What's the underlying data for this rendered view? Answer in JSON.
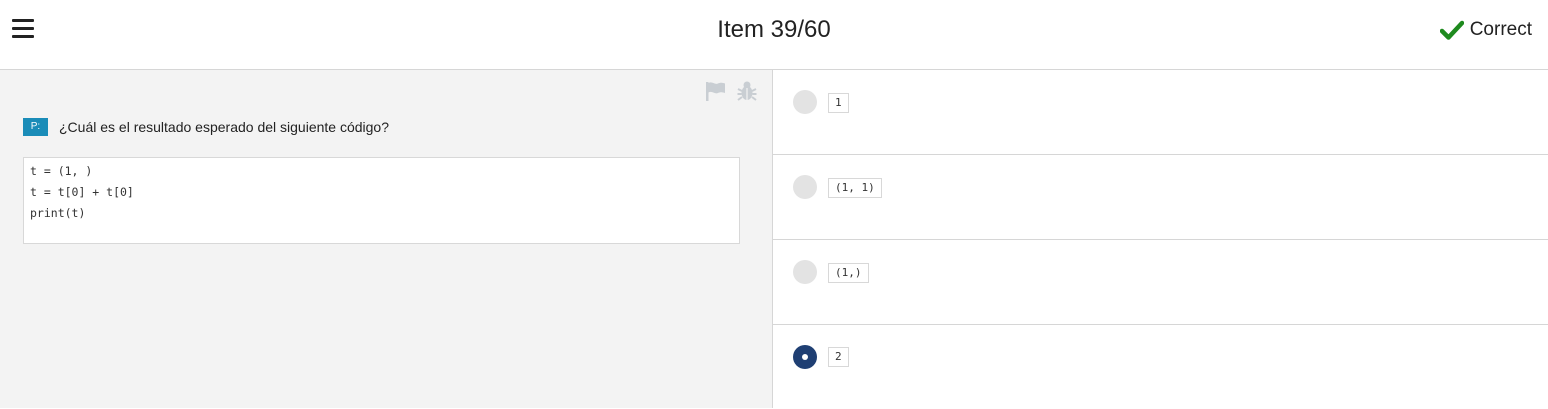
{
  "header": {
    "title": "Item 39/60",
    "status_label": "Correct",
    "status_color": "#1e8a1e",
    "menu_icon": "hamburger-menu-icon"
  },
  "question": {
    "badge": "P:",
    "text": "¿Cuál es el resultado esperado del siguiente código?",
    "code_lines": [
      "t = (1, )",
      "t = t[0] + t[0]",
      "print(t)"
    ],
    "tools": [
      "flag-icon",
      "bug-icon"
    ]
  },
  "options": [
    {
      "code": "1",
      "selected": false
    },
    {
      "code": "(1, 1)",
      "selected": false
    },
    {
      "code": "(1,)",
      "selected": false
    },
    {
      "code": "2",
      "selected": true
    }
  ],
  "colors": {
    "badge": "#1a8cb8",
    "selected_radio": "#1f3f73",
    "left_pane_bg": "#f3f3f3"
  }
}
